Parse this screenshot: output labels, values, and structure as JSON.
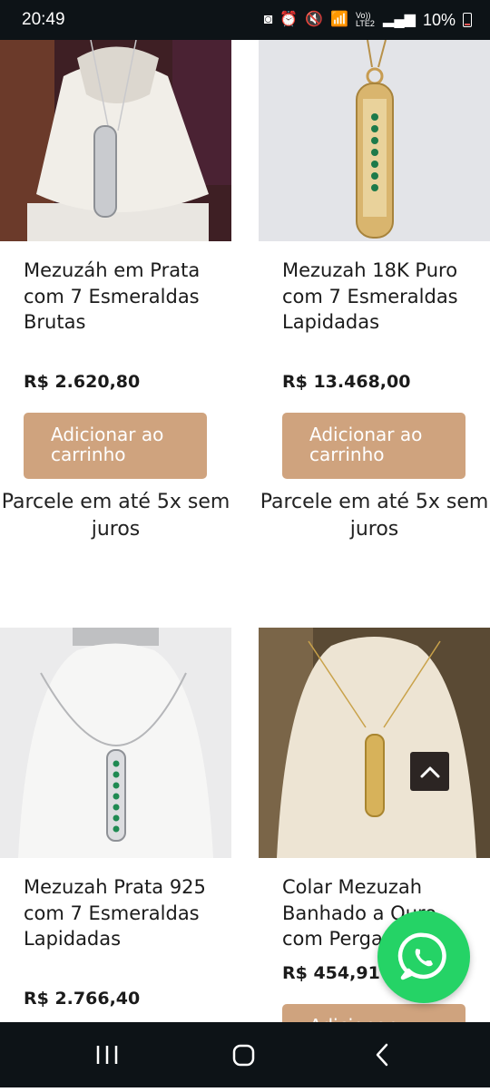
{
  "status_bar": {
    "time": "20:49",
    "network_label": "Vo)) LTE2",
    "battery_percent": "10%"
  },
  "products": [
    {
      "name": "Mezuzáh em Prata com 7 Esmeraldas Brutas",
      "price": "R$ 2.620,80",
      "button_label": "Adicionar ao carrinho",
      "installments": "Parcele em até 5x sem juros"
    },
    {
      "name": "Mezuzah 18K Puro com 7 Esmeraldas Lapidadas",
      "price": "R$ 13.468,00",
      "button_label": "Adicionar ao carrinho",
      "installments": "Parcele em até 5x sem juros"
    },
    {
      "name": "Mezuzah Prata 925 com 7 Esmeraldas Lapidadas",
      "price": "R$ 2.766,40"
    },
    {
      "name": "Colar Mezuzah Banhado a Ouro com Pergaminho",
      "price": "R$ 454,91",
      "button_label": "Adicionar"
    }
  ],
  "icons": {
    "scroll_top": "chevron-up-icon",
    "whatsapp": "whatsapp-icon",
    "nav_recents": "recents-icon",
    "nav_home": "home-icon",
    "nav_back": "back-icon"
  },
  "colors": {
    "button_bg": "#cfa37e",
    "whatsapp_green": "#25d366",
    "system_bar": "#0d1317"
  }
}
